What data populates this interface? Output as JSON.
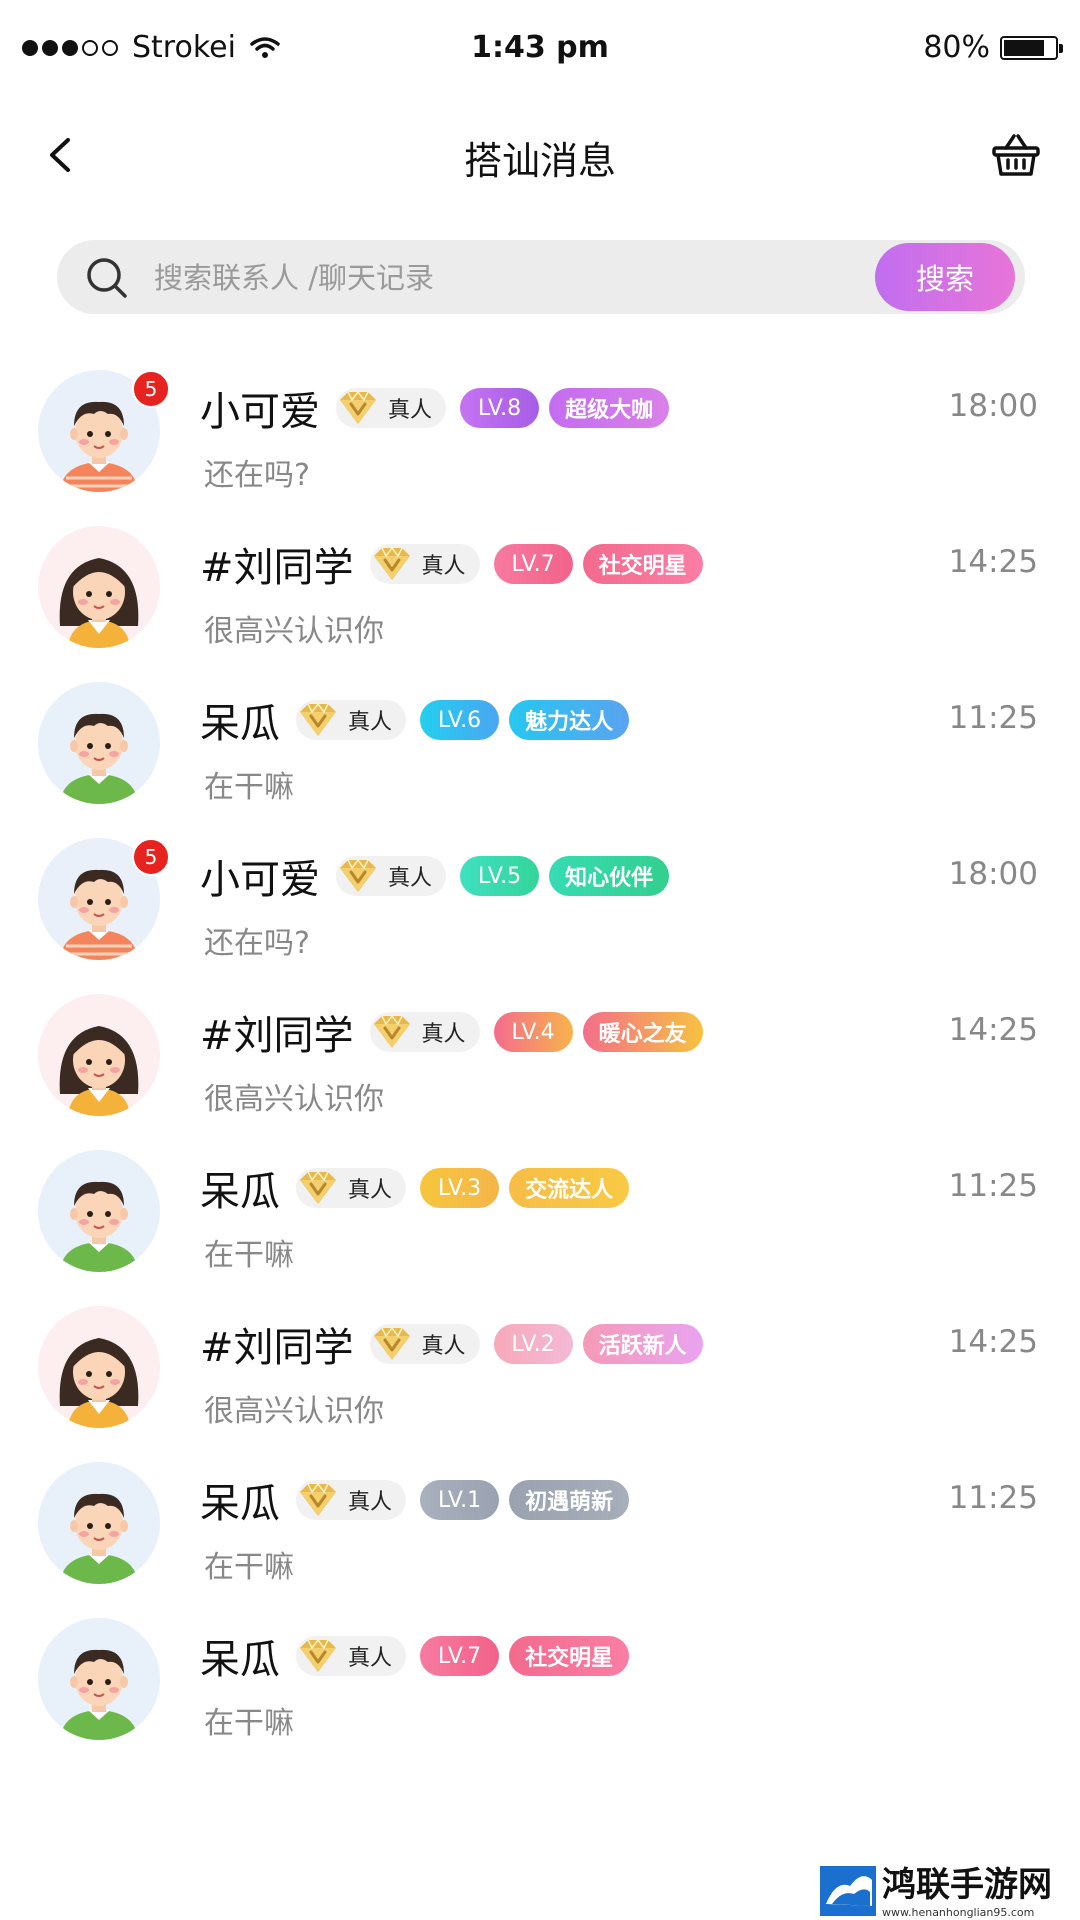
{
  "status_bar": {
    "carrier": "Strokei",
    "time": "1:43 pm",
    "battery": "80%",
    "battery_level": 0.8
  },
  "nav": {
    "title": "搭讪消息"
  },
  "search": {
    "placeholder": "搜索联系人 /聊天记录",
    "button": "搜索"
  },
  "real_label": "真人",
  "chats": [
    {
      "name": "小可爱",
      "level": "LV.8",
      "title": "超级大咖",
      "time": "18:00",
      "message": "还在吗?",
      "unread": "5",
      "avatar": "boy-orange",
      "lv_color": [
        "#c573f2",
        "#a65de6"
      ],
      "title_color": [
        "#c36cf0",
        "#d980e8"
      ]
    },
    {
      "name": "#刘同学",
      "level": "LV.7",
      "title": "社交明星",
      "time": "14:25",
      "message": "很高兴认识你",
      "unread": "",
      "avatar": "girl",
      "lv_color": [
        "#f77aa0",
        "#f2628a"
      ],
      "title_color": [
        "#f36a8e",
        "#fa7ea4"
      ]
    },
    {
      "name": "呆瓜",
      "level": "LV.6",
      "title": "魅力达人",
      "time": "11:25",
      "message": "在干嘛",
      "unread": "",
      "avatar": "boy-green",
      "lv_color": [
        "#22cfee",
        "#4aa6f2"
      ],
      "title_color": [
        "#26c7f0",
        "#5aa3f0"
      ]
    },
    {
      "name": "小可爱",
      "level": "LV.5",
      "title": "知心伙伴",
      "time": "18:00",
      "message": "还在吗?",
      "unread": "5",
      "avatar": "boy-orange",
      "lv_color": [
        "#3fe0c0",
        "#34d49a"
      ],
      "title_color": [
        "#37dbb4",
        "#33cf8e"
      ]
    },
    {
      "name": "#刘同学",
      "level": "LV.4",
      "title": "暖心之友",
      "time": "14:25",
      "message": "很高兴认识你",
      "unread": "",
      "avatar": "girl",
      "lv_color": [
        "#f46c8c",
        "#f7b34a"
      ],
      "title_color": [
        "#f36e8a",
        "#f7c240"
      ]
    },
    {
      "name": "呆瓜",
      "level": "LV.3",
      "title": "交流达人",
      "time": "11:25",
      "message": "在干嘛",
      "unread": "",
      "avatar": "boy-green",
      "lv_color": [
        "#f7c63c",
        "#f5b54a"
      ],
      "title_color": [
        "#f7bd46",
        "#f8ca45"
      ]
    },
    {
      "name": "#刘同学",
      "level": "LV.2",
      "title": "活跃新人",
      "time": "14:25",
      "message": "很高兴认识你",
      "unread": "",
      "avatar": "girl",
      "lv_color": [
        "#f7a9b9",
        "#f3b9d6"
      ],
      "title_color": [
        "#f59ab7",
        "#e9a3f1"
      ]
    },
    {
      "name": "呆瓜",
      "level": "LV.1",
      "title": "初遇萌新",
      "time": "11:25",
      "message": "在干嘛",
      "unread": "",
      "avatar": "boy-green",
      "lv_color": [
        "#a9b0bd",
        "#9aa2b1"
      ],
      "title_color": [
        "#9aa2b0",
        "#a7aeba"
      ]
    },
    {
      "name": "呆瓜",
      "level": "LV.7",
      "title": "社交明星",
      "time": "",
      "message": "在干嘛",
      "unread": "",
      "avatar": "boy-green",
      "lv_color": [
        "#f77aa0",
        "#f2628a"
      ],
      "title_color": [
        "#f36a8e",
        "#fa7ea4"
      ]
    }
  ],
  "watermark": {
    "title": "鸿联手游网",
    "url": "www.henanhonglian95.com"
  }
}
